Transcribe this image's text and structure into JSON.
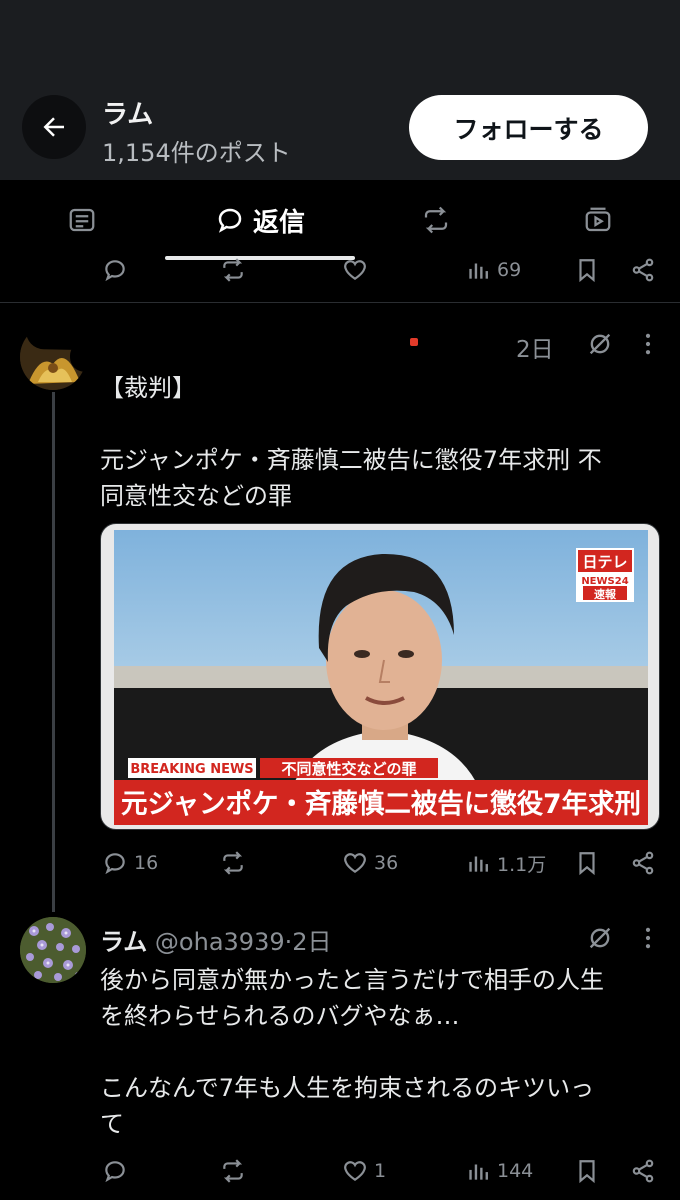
{
  "header": {
    "profile_name": "ラム",
    "post_count": "1,154件のポスト",
    "follow_label": "フォローする"
  },
  "tabs": {
    "active_label": "返信"
  },
  "top_actions": {
    "views": "69"
  },
  "post1": {
    "time": "2日",
    "text_line1": "【裁判】",
    "text_line2": "元ジャンポケ・斉藤慎二被告に懲役7年求刑 不\n同意性交などの罪",
    "media": {
      "logo_top": "日テレ",
      "logo_mid": "NEWS24",
      "logo_bottom": "速報",
      "breaking": "BREAKING NEWS",
      "sub_caption": "不同意性交などの罪",
      "headline": "元ジャンポケ・斉藤慎二被告に懲役7年求刑"
    },
    "replies": "16",
    "likes": "36",
    "views": "1.1万"
  },
  "post2": {
    "name": "ラム",
    "handle": "@oha3939",
    "sep": "·",
    "time": "2日",
    "text": "後から同意が無かったと言うだけで相手の人生\nを終わらせられるのバグやなぁ…\n\nこんなんで7年も人生を拘束されるのキツいっ\nて",
    "likes": "1",
    "views": "144"
  },
  "colors": {
    "background": "#000000",
    "header_bg": "#1b1d20",
    "text": "#e7e9ea",
    "muted": "#8b9096",
    "breaking_red": "#d2261f"
  }
}
